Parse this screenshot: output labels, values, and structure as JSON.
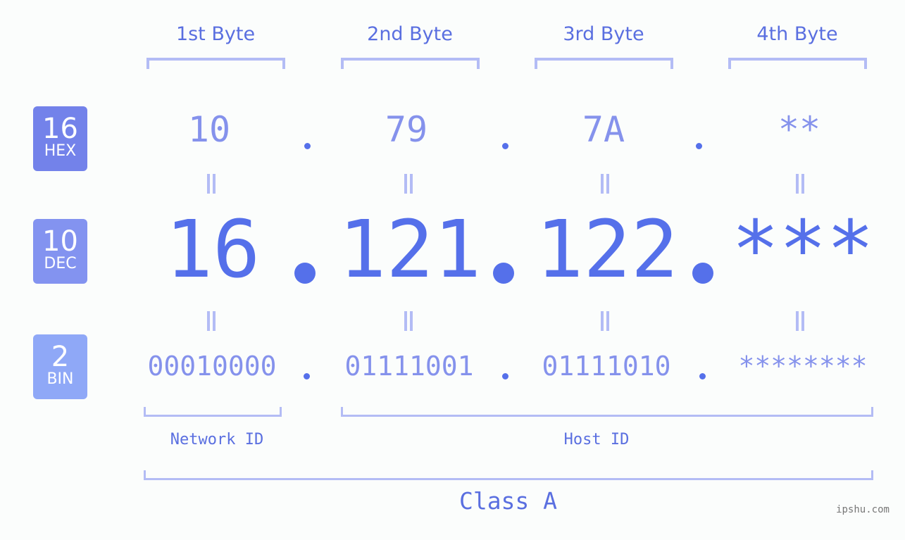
{
  "byte_headers": [
    "1st Byte",
    "2nd Byte",
    "3rd Byte",
    "4th Byte"
  ],
  "badges": {
    "hex": {
      "number": "16",
      "label": "HEX",
      "color": "#7382ea"
    },
    "dec": {
      "number": "10",
      "label": "DEC",
      "color": "#8393f0"
    },
    "bin": {
      "number": "2",
      "label": "BIN",
      "color": "#8fa8f7"
    }
  },
  "hex_values": [
    "10",
    "79",
    "7A",
    "**"
  ],
  "dec_values": [
    "16",
    "121",
    "122",
    "***"
  ],
  "bin_values": [
    "00010000",
    "01111001",
    "01111010",
    "********"
  ],
  "network_id_label": "Network ID",
  "host_id_label": "Host ID",
  "class_label": "Class A",
  "watermark": "ipshu.com",
  "colors": {
    "primary": "#5570ea",
    "secondary": "#8592ec",
    "bracket": "#b3bcf5",
    "background": "#fbfdfc"
  }
}
